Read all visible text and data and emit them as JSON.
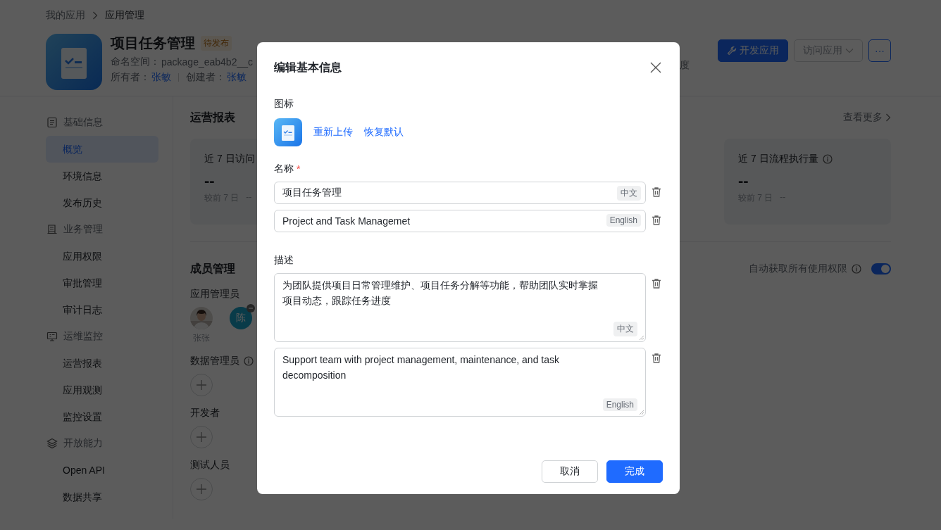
{
  "breadcrumb": [
    {
      "label": "我的应用"
    },
    {
      "label": "应用管理"
    }
  ],
  "app": {
    "title": "项目任务管理",
    "status": "待发布",
    "namespace_label": "命名空间：",
    "namespace": "package_eab4b2__c",
    "owner_label": "所有者：",
    "owner": "张敏",
    "creator_label": "创建者：",
    "creator": "张敏",
    "right_cut": "度"
  },
  "actions": [
    {
      "label": "开发应用",
      "kind": "primary"
    },
    {
      "label": "访问应用",
      "kind": "dropdown"
    },
    {
      "label": "···",
      "kind": "more"
    }
  ],
  "sidebar": [
    {
      "label": "基础信息",
      "children": [
        {
          "label": "概览",
          "selected": true
        },
        {
          "label": "环境信息",
          "selected": false
        },
        {
          "label": "发布历史",
          "selected": false
        }
      ]
    },
    {
      "label": "业务管理",
      "children": [
        {
          "label": "应用权限",
          "selected": false
        },
        {
          "label": "审批管理",
          "selected": false
        },
        {
          "label": "审计日志",
          "selected": false
        }
      ]
    },
    {
      "label": "运维监控",
      "children": [
        {
          "label": "运营报表",
          "selected": false
        },
        {
          "label": "应用观测",
          "selected": false
        },
        {
          "label": "监控设置",
          "selected": false
        }
      ]
    },
    {
      "label": "开放能力",
      "children": [
        {
          "label": "Open API",
          "selected": false
        },
        {
          "label": "数据共享",
          "selected": false
        }
      ]
    }
  ],
  "report": {
    "title": "运营报表",
    "more": "查看更多",
    "cards": [
      {
        "title": "近 7 日访问",
        "value": "--",
        "compare_label": "较前 7 日",
        "compare": "--",
        "info": false
      },
      {
        "title": "近 7 日流程执行量",
        "value": "--",
        "compare_label": "较前 7 日",
        "compare": "--",
        "info": true
      }
    ]
  },
  "members": {
    "title": "成员管理",
    "auto_label": "自动获取所有使用权限",
    "auto_on": true,
    "groups": [
      {
        "label": "应用管理员",
        "info": false,
        "members": [
          {
            "name": "张张",
            "removable": false
          },
          {
            "kind": "initial",
            "initial": "陈",
            "removable": true
          }
        ]
      },
      {
        "label": "数据管理员",
        "info": true
      },
      {
        "label": "开发者",
        "info": false
      },
      {
        "label": "测试人员",
        "info": false
      }
    ]
  },
  "dialog": {
    "title": "编辑基本信息",
    "icon_label": "图标",
    "icon_links": [
      "重新上传",
      "恢复默认"
    ],
    "name_label": "名称",
    "required_mark": "*",
    "names": [
      {
        "value": "项目任务管理",
        "lang": "中文"
      },
      {
        "value": "Project and Task Managemet",
        "lang": "English"
      }
    ],
    "desc_label": "描述",
    "descriptions": [
      {
        "value": "为团队提供项目日常管理维护、项目任务分解等功能，帮助团队实时掌握项目动态，跟踪任务进度",
        "lang": "中文"
      },
      {
        "value": "Support team with project management, maintenance, and task decomposition",
        "lang": "English"
      }
    ],
    "buttons": [
      {
        "label": "取消",
        "kind": "secondary"
      },
      {
        "label": "完成",
        "kind": "primary"
      }
    ]
  }
}
